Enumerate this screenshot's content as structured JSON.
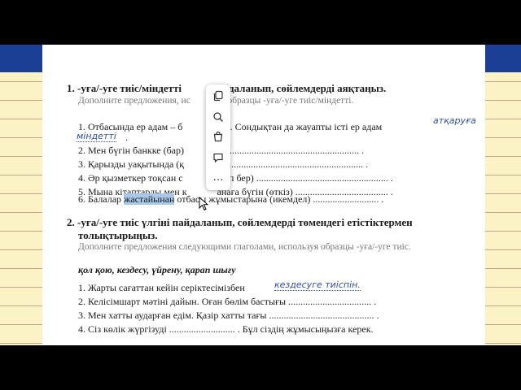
{
  "ex1": {
    "heading_pre": "1. -уға/-уге тиіс/міндетті ",
    "heading_post": " пайдаланып, сөйлемдерді аяқтаңыз.",
    "subtitle": "Дополните предложения, ис",
    "subtitle_tail": "уя образцы -уға/-уге тиіс/міндетті.",
    "line1": "1. Отбасында ер адам – б",
    "line1_tail": "ұлға. Сондықтан да жауапты істі ер адам",
    "handwritten_answer_a": "атқаруға",
    "handwritten_answer_b": "міндетті",
    "line2": "2. Мен бүгін банкке (бар)",
    "line2_tail": "........................................................... .",
    "line3": "3. Қарызды уақытында (қ",
    "line3_tail": ") ........................................................... .",
    "line4": "4. Әр қызметкер тоқсан с",
    "line4_tail": "есеп бер) ...................................................... .",
    "line5": "5. Мына кітаптарды мен к",
    "line5_tail": "анаға бүгін (өткіз) ...................................... .",
    "line6_pre": "6. Балалар ",
    "line6_highlight": "жастайынан",
    "line6_post": " отбасы жұмыстарына (икемдел) ........................... ."
  },
  "ex2": {
    "heading_line1": "2. -уға/-уге тиіс үлгіні пайдаланып, сөйлемдерді төмендегі етістіктермен",
    "heading_line2": "толықтырыңыз.",
    "subtitle": "Дополните предложения следующими глаголами, используя образцы -уға/-уге тиіс.",
    "verbs": "қол қою, кездесу, үйрену, қарап шығу",
    "line1": "1. Жарты сағаттан кейін серіктесімізбен",
    "handwritten_answer": "кездесуге тиіспін.",
    "line2": "2. Келісімшарт мәтіні дайын. Оған бөлім бастығы .................................. .",
    "line3": "3. Мен хатты аударған едім. Қазір хатты тағы ........................................... .",
    "line4": "4. Сіз көлік жүргізуді ........................... . Бұл сіздің жұмысыңызға керек."
  },
  "popup": {
    "items": [
      {
        "icon": "copy-icon"
      },
      {
        "icon": "search-icon"
      },
      {
        "icon": "shopping-bag-icon"
      },
      {
        "icon": "comment-icon"
      },
      {
        "icon": "more-icon",
        "label": "…"
      }
    ]
  },
  "colors": {
    "band": "#1c3f96",
    "lined_paper": "#fbf3c6",
    "highlight": "#a8c8ea",
    "handwriting": "#2e4e9c"
  }
}
